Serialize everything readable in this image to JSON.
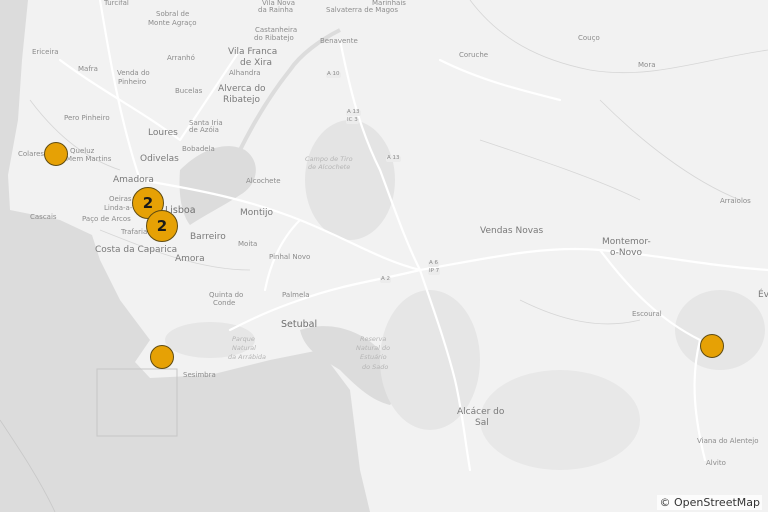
{
  "attribution": "© OpenStreetMap",
  "markers": [
    {
      "id": "colares",
      "type": "single"
    },
    {
      "id": "lisboa-north",
      "type": "cluster",
      "count": "2"
    },
    {
      "id": "lisboa-south",
      "type": "cluster",
      "count": "2"
    },
    {
      "id": "sesimbra",
      "type": "single"
    },
    {
      "id": "evora-area",
      "type": "single"
    }
  ],
  "places": {
    "turcifal": "Turcifal",
    "sobral": "Sobral de",
    "monte_agraco": "Monte Agraço",
    "vila_nova": "Vila Nova",
    "da_rainha": "da Rainha",
    "salvaterra": "Salvaterra de Magos",
    "marinhais": "Marinhais",
    "castanheira": "Castanheira",
    "do_ribatejo": "do Ribatejo",
    "benavente": "Benavente",
    "vila_franca": "Vila Franca",
    "de_xira": "de Xira",
    "alhandra": "Alhandra",
    "arranho": "Arranhó",
    "ericeira": "Ericeira",
    "mafra": "Mafra",
    "venda_do": "Venda do",
    "pinheiro": "Pinheiro",
    "bucelas": "Bucelas",
    "alverca": "Alverca do",
    "ribatejo": "Ribatejo",
    "coruche": "Coruche",
    "couco": "Couço",
    "mora": "Mora",
    "pero_pinheiro": "Pero Pinheiro",
    "loures": "Loures",
    "santa_iria": "Santa Iria",
    "de_azoia": "de Azóia",
    "bobadela": "Bobadela",
    "colares": "Colares",
    "queluz": "Queluz",
    "mem_martins": "Mem Martins",
    "odivelas": "Odivelas",
    "campo_de_tiro": "Campo de Tiro",
    "de_alcochete": "de Alcochete",
    "alcochete": "Alcochete",
    "amadora": "Amadora",
    "oeiras": "Oeiras",
    "cascais": "Cascais",
    "linda_a_velha": "Linda-a-Velha",
    "paco_de_arcos": "Paço de Arcos",
    "lisboa": "Lisboa",
    "montijo": "Montijo",
    "arraiolos": "Arraiolos",
    "trafaria": "Trafaria",
    "barreiro": "Barreiro",
    "moita": "Moita",
    "vendas_novas": "Vendas Novas",
    "montemor": "Montemor-",
    "o_novo": "o-Novo",
    "costa_caparica": "Costa da Caparica",
    "amora": "Amora",
    "pinhal_novo": "Pinhal Novo",
    "quinta_do": "Quinta do",
    "conde": "Conde",
    "palmela": "Palmela",
    "evora": "Év",
    "escoural": "Escoural",
    "setubal": "Setubal",
    "parque_natural": "Parque",
    "natural": "Natural",
    "da_arrabida": "da Arrábida",
    "reserva": "Reserva",
    "natural_do": "Natural do",
    "estuario": "Estuário",
    "do_sado": "do Sado",
    "sesimbra": "Sesimbra",
    "alcacer": "Alcácer do",
    "sal": "Sal",
    "viana": "Viana do Alentejo",
    "alvito": "Alvito",
    "estuario_tejo": "Reserva Natural do Estuário do Tejo"
  },
  "roads": {
    "a10": "A 10",
    "a13": "A 13",
    "ic3": "IC 3",
    "a13b": "A 13",
    "a6": "A 6",
    "ip7": "IP 7",
    "a2": "A 2"
  }
}
